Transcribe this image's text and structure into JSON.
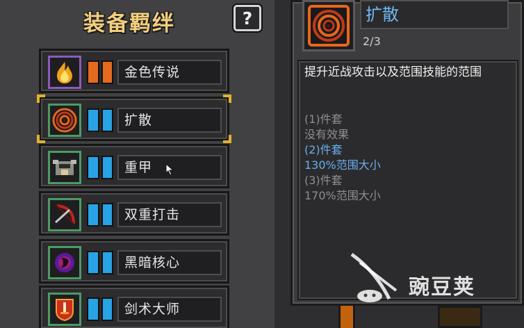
{
  "panel": {
    "title": "装备羁绊",
    "help_label": "?"
  },
  "bonds": [
    {
      "name": "金色传说",
      "icon": "flame-icon",
      "tier_color": "#e66a1e",
      "border_color": "#8a5bbd"
    },
    {
      "name": "扩散",
      "icon": "ripple-target-icon",
      "tier_color": "#27a3e6",
      "border_color": "#4e9a64",
      "selected": true
    },
    {
      "name": "重甲",
      "icon": "armor-helmet-icon",
      "tier_color": "#27a3e6",
      "border_color": "#4e9a64"
    },
    {
      "name": "双重打击",
      "icon": "crossbow-icon",
      "tier_color": "#27a3e6",
      "border_color": "#4e9a64"
    },
    {
      "name": "黑暗核心",
      "icon": "dark-orb-icon",
      "tier_color": "#27a3e6",
      "border_color": "#4e9a64"
    },
    {
      "name": "剑术大师",
      "icon": "sword-shield-icon",
      "tier_color": "#27a3e6",
      "border_color": "#4e9a64"
    }
  ],
  "detail": {
    "title": "扩散",
    "count": "2/3",
    "description": "提升近战攻击以及范围技能的范围",
    "tiers": [
      {
        "text": "(1)件套",
        "active": false
      },
      {
        "text": "没有效果",
        "active": false
      },
      {
        "text": "(2)件套",
        "active": true
      },
      {
        "text": "130%范围大小",
        "active": true
      },
      {
        "text": "(3)件套",
        "active": false
      },
      {
        "text": "170%范围大小",
        "active": false
      }
    ]
  },
  "watermark": {
    "text": "豌豆荚"
  },
  "colors": {
    "title_gold": "#f3cf7e",
    "active_blue": "#6aaef0",
    "selection_gold": "#e2b02e"
  }
}
